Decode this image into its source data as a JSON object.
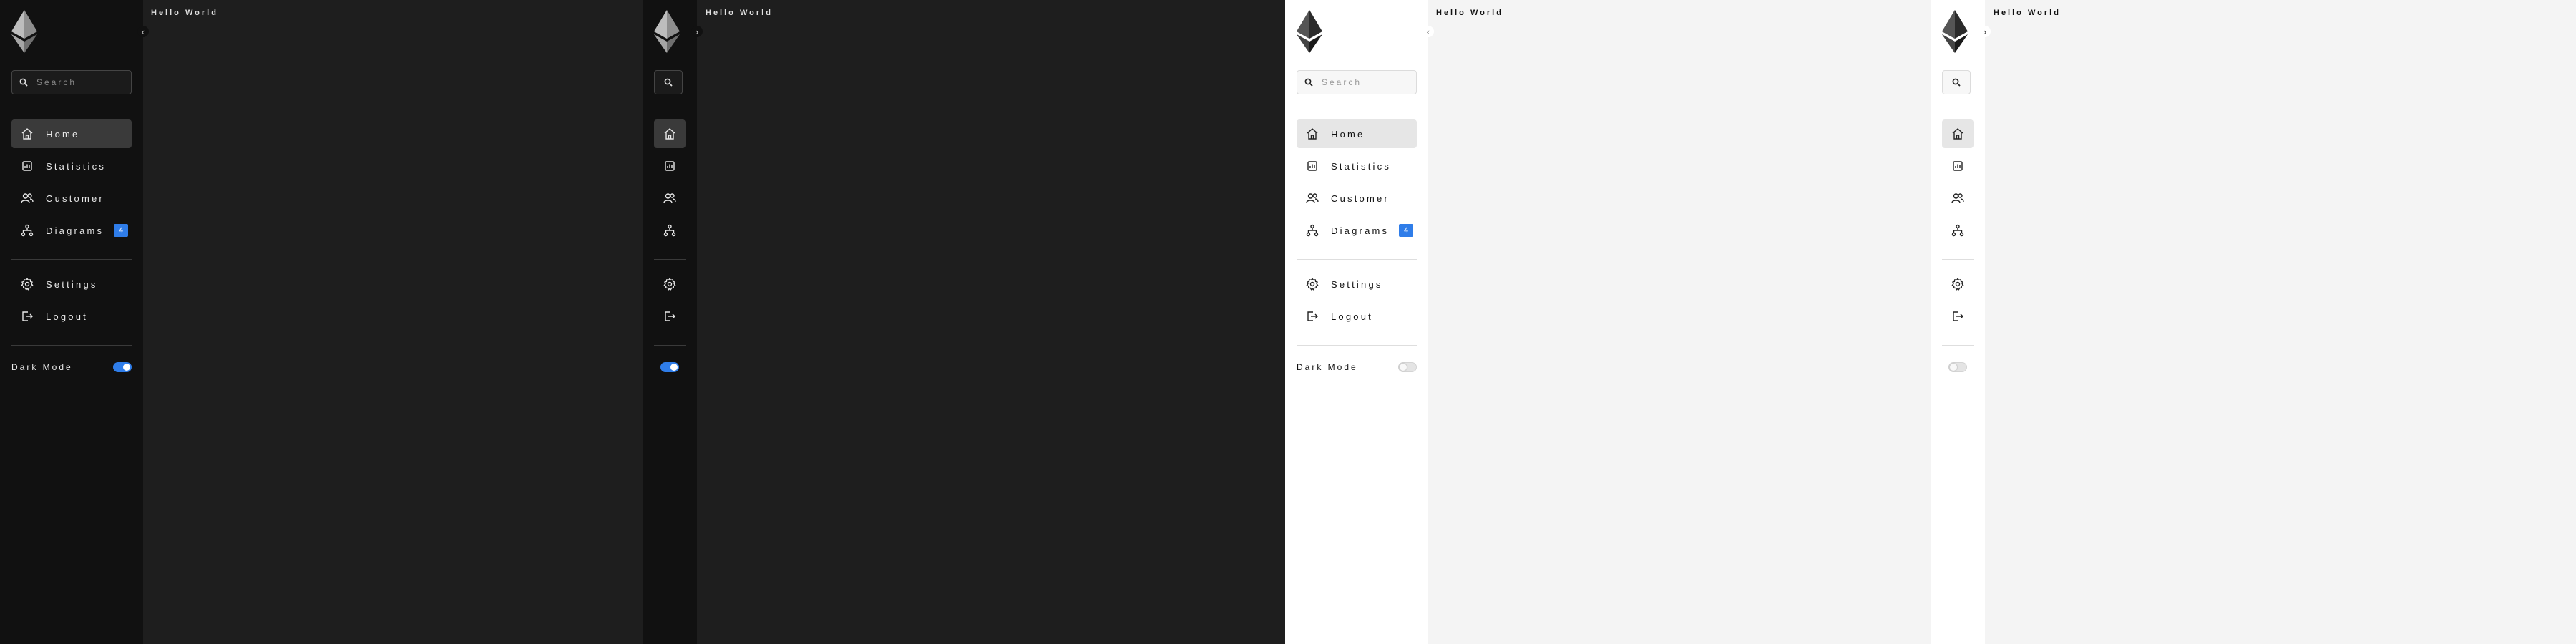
{
  "content": {
    "title": "Hello World"
  },
  "sidebar": {
    "collapse_glyph": "‹",
    "expand_glyph": "›",
    "search": {
      "placeholder": "Search",
      "value": ""
    },
    "nav_items": [
      {
        "label": "Home",
        "icon": "home-icon",
        "active": true
      },
      {
        "label": "Statistics",
        "icon": "statistics-icon"
      },
      {
        "label": "Customer",
        "icon": "customer-icon"
      },
      {
        "label": "Diagrams",
        "icon": "diagrams-icon",
        "badge": "4"
      }
    ],
    "bottom_items": [
      {
        "label": "Settings",
        "icon": "gear-icon"
      },
      {
        "label": "Logout",
        "icon": "logout-icon"
      }
    ],
    "dark_mode_label": "Dark Mode"
  },
  "panels": [
    {
      "theme": "dark",
      "collapsed": false,
      "dark_mode": true
    },
    {
      "theme": "dark",
      "collapsed": true,
      "dark_mode": true
    },
    {
      "theme": "light",
      "collapsed": false,
      "dark_mode": false
    },
    {
      "theme": "light",
      "collapsed": true,
      "dark_mode": false
    }
  ],
  "colors": {
    "accent": "#2f7de9",
    "dark_bg": "#1e1e1e",
    "dark_sidebar": "#111111",
    "light_bg": "#f4f4f4",
    "light_sidebar": "#ffffff"
  }
}
